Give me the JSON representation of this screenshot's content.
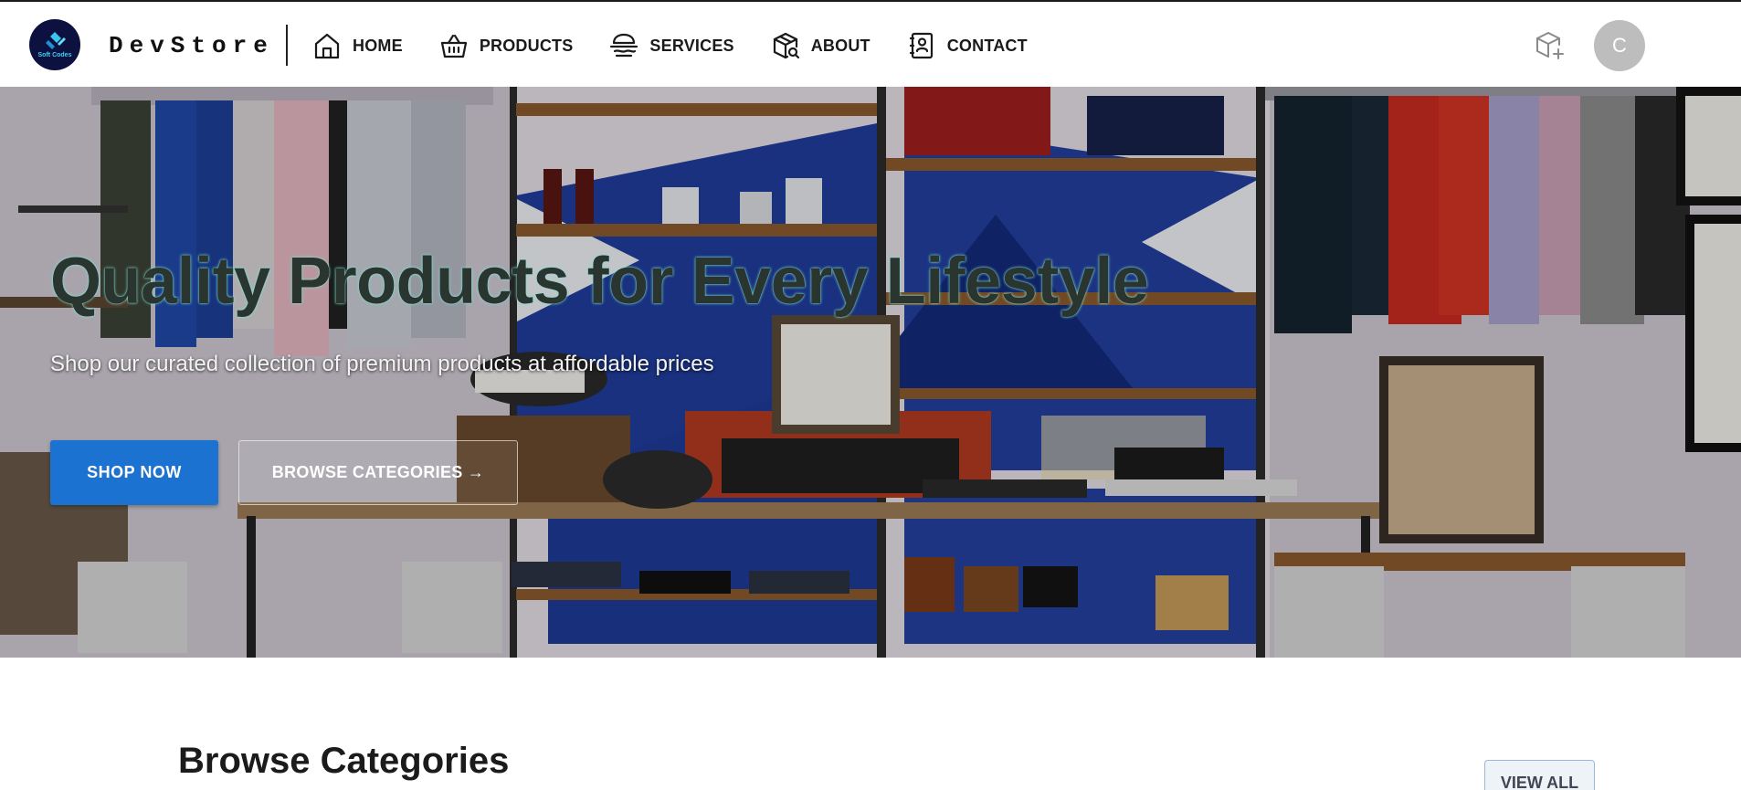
{
  "brand": {
    "name": "DevStore",
    "logo_text": "Soft Codes"
  },
  "nav": {
    "items": [
      {
        "label": "HOME",
        "icon": "home-icon"
      },
      {
        "label": "PRODUCTS",
        "icon": "basket-icon"
      },
      {
        "label": "SERVICES",
        "icon": "service-icon"
      },
      {
        "label": "ABOUT",
        "icon": "package-search-icon"
      },
      {
        "label": "CONTACT",
        "icon": "contact-card-icon"
      }
    ],
    "cart_icon": "box-plus-icon",
    "avatar_letter": "C"
  },
  "hero": {
    "title": "Quality Products for Every Lifestyle",
    "subtitle": "Shop our curated collection of premium products at affordable prices",
    "primary_button": "SHOP NOW",
    "secondary_button": "BROWSE CATEGORIES →"
  },
  "categories": {
    "title": "Browse Categories",
    "view_all": "VIEW ALL"
  },
  "colors": {
    "primary": "#1c72d0",
    "logo_bg": "#0c1140",
    "avatar_bg": "#bdbdbd"
  }
}
